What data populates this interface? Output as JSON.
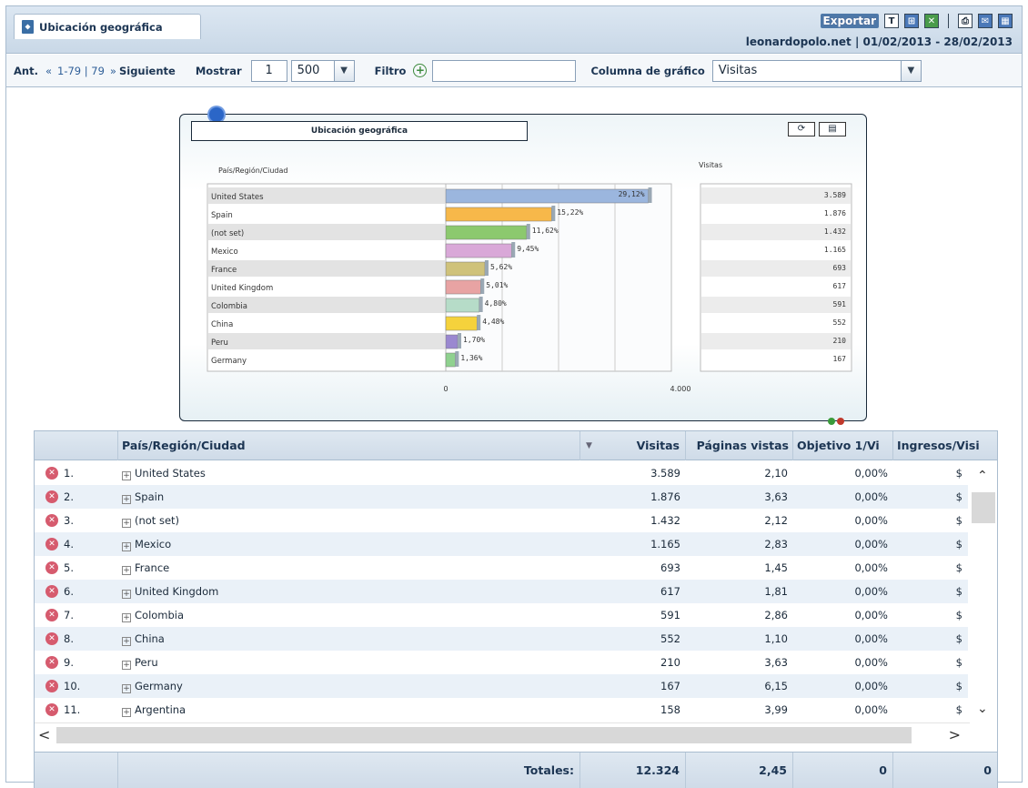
{
  "window": {
    "tab_title": "Ubicación geográfica",
    "export_label": "Exportar",
    "site": "leonardopolo.net",
    "date_range": "01/02/2013 - 28/02/2013"
  },
  "toolbar": {
    "prev_label": "Ant.",
    "prev_arrows": "«",
    "range": "1-79 | 79",
    "next_arrows": "»",
    "next_label": "Siguiente",
    "show_label": "Mostrar",
    "show_from": "1",
    "show_count": "500",
    "filter_label": "Filtro",
    "filter_value": "",
    "chart_column_label": "Columna de gráfico",
    "chart_column_value": "Visitas"
  },
  "chart_data": {
    "type": "bar",
    "title": "Ubicación geográfica",
    "category_header": "País/Región/Ciudad",
    "value_header": "Visitas",
    "categories": [
      "United States",
      "Spain",
      "(not set)",
      "Mexico",
      "France",
      "United Kingdom",
      "Colombia",
      "China",
      "Peru",
      "Germany"
    ],
    "values": [
      3589,
      1876,
      1432,
      1165,
      693,
      617,
      591,
      552,
      210,
      167
    ],
    "value_labels": [
      "3.589",
      "1.876",
      "1.432",
      "1.165",
      "693",
      "617",
      "591",
      "552",
      "210",
      "167"
    ],
    "percent_labels": [
      "29,12%",
      "15,22%",
      "11,62%",
      "9,45%",
      "5,62%",
      "5,01%",
      "4,80%",
      "4,48%",
      "1,70%",
      "1,36%"
    ],
    "axis_ticks": [
      "0",
      "4.000"
    ],
    "xlim": [
      0,
      4000
    ],
    "colors": [
      "#9bb6de",
      "#f7b84a",
      "#8cc96e",
      "#d9a8d8",
      "#cfc27a",
      "#e8a3a3",
      "#b6dcc8",
      "#f5d23c",
      "#9a88d0",
      "#8fd18f"
    ]
  },
  "table": {
    "columns": [
      "País/Región/Ciudad",
      "Visitas",
      "Páginas vistas",
      "Objetivo 1/Vi",
      "Ingresos/Visi"
    ],
    "rows": [
      {
        "idx": "1.",
        "name": "United States",
        "visits": "3.589",
        "pages": "2,10",
        "goal": "0,00%",
        "rev": "$"
      },
      {
        "idx": "2.",
        "name": "Spain",
        "visits": "1.876",
        "pages": "3,63",
        "goal": "0,00%",
        "rev": "$"
      },
      {
        "idx": "3.",
        "name": "(not set)",
        "visits": "1.432",
        "pages": "2,12",
        "goal": "0,00%",
        "rev": "$"
      },
      {
        "idx": "4.",
        "name": "Mexico",
        "visits": "1.165",
        "pages": "2,83",
        "goal": "0,00%",
        "rev": "$"
      },
      {
        "idx": "5.",
        "name": "France",
        "visits": "693",
        "pages": "1,45",
        "goal": "0,00%",
        "rev": "$"
      },
      {
        "idx": "6.",
        "name": "United Kingdom",
        "visits": "617",
        "pages": "1,81",
        "goal": "0,00%",
        "rev": "$"
      },
      {
        "idx": "7.",
        "name": "Colombia",
        "visits": "591",
        "pages": "2,86",
        "goal": "0,00%",
        "rev": "$"
      },
      {
        "idx": "8.",
        "name": "China",
        "visits": "552",
        "pages": "1,10",
        "goal": "0,00%",
        "rev": "$"
      },
      {
        "idx": "9.",
        "name": "Peru",
        "visits": "210",
        "pages": "3,63",
        "goal": "0,00%",
        "rev": "$"
      },
      {
        "idx": "10.",
        "name": "Germany",
        "visits": "167",
        "pages": "6,15",
        "goal": "0,00%",
        "rev": "$"
      },
      {
        "idx": "11.",
        "name": "Argentina",
        "visits": "158",
        "pages": "3,99",
        "goal": "0,00%",
        "rev": "$"
      }
    ],
    "totals": {
      "label": "Totales:",
      "visits": "12.324",
      "pages": "2,45",
      "goal": "0",
      "rev": "0"
    }
  }
}
